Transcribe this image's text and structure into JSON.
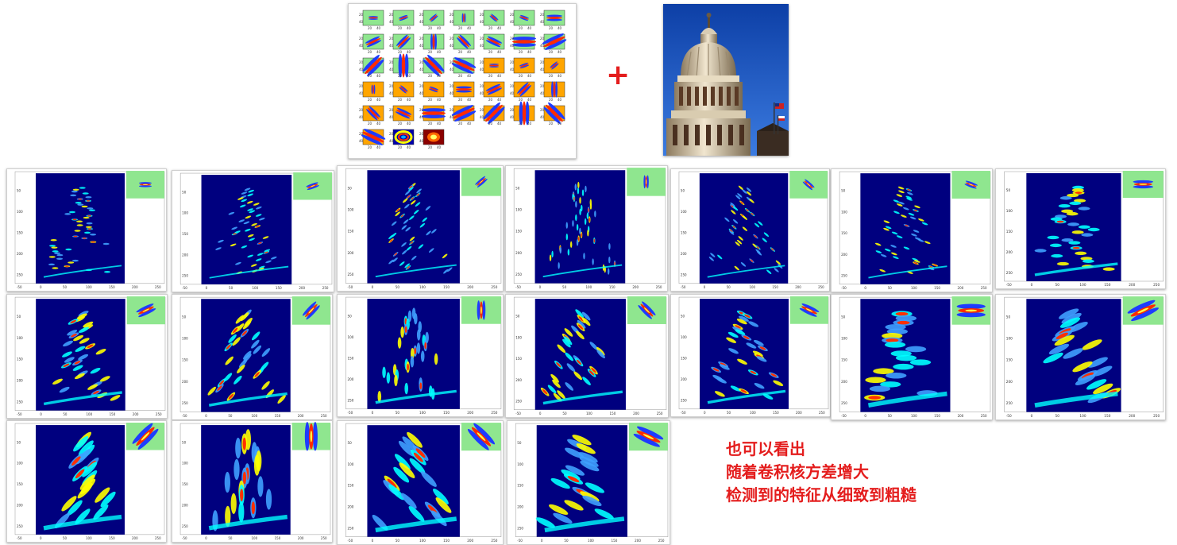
{
  "colors": {
    "accent_red": "#e41d1d",
    "map_background": "#00007f",
    "filter_bg_green": "#8fe68f",
    "filter_bg_orange": "#ffa500"
  },
  "filter_bank": {
    "tick_labels": [
      "20",
      "40"
    ],
    "rows": [
      [
        {
          "bg": "green",
          "angle": 0,
          "size": "s"
        },
        {
          "bg": "green",
          "angle": -20,
          "size": "s"
        },
        {
          "bg": "green",
          "angle": -40,
          "size": "s"
        },
        {
          "bg": "green",
          "angle": -90,
          "size": "s"
        },
        {
          "bg": "green",
          "angle": 40,
          "size": "s"
        },
        {
          "bg": "green",
          "angle": 20,
          "size": "s"
        },
        {
          "bg": "green",
          "angle": 0,
          "size": "m"
        }
      ],
      [
        {
          "bg": "green",
          "angle": -25,
          "size": "m"
        },
        {
          "bg": "green",
          "angle": -45,
          "size": "m"
        },
        {
          "bg": "green",
          "angle": -90,
          "size": "m"
        },
        {
          "bg": "green",
          "angle": 45,
          "size": "m"
        },
        {
          "bg": "green",
          "angle": 25,
          "size": "m"
        },
        {
          "bg": "green",
          "angle": 0,
          "size": "l"
        },
        {
          "bg": "green",
          "angle": -25,
          "size": "l"
        }
      ],
      [
        {
          "bg": "green",
          "angle": -45,
          "size": "l"
        },
        {
          "bg": "green",
          "angle": -90,
          "size": "l"
        },
        {
          "bg": "green",
          "angle": 45,
          "size": "l"
        },
        {
          "bg": "green",
          "angle": 25,
          "size": "l"
        },
        {
          "bg": "orange",
          "angle": 0,
          "size": "s"
        },
        {
          "bg": "orange",
          "angle": -20,
          "size": "s"
        },
        {
          "bg": "orange",
          "angle": -40,
          "size": "s"
        }
      ],
      [
        {
          "bg": "orange",
          "angle": -90,
          "size": "s"
        },
        {
          "bg": "orange",
          "angle": 40,
          "size": "s"
        },
        {
          "bg": "orange",
          "angle": 20,
          "size": "s"
        },
        {
          "bg": "orange",
          "angle": 0,
          "size": "m"
        },
        {
          "bg": "orange",
          "angle": -25,
          "size": "m"
        },
        {
          "bg": "orange",
          "angle": -45,
          "size": "m"
        },
        {
          "bg": "orange",
          "angle": -90,
          "size": "m"
        }
      ],
      [
        {
          "bg": "orange",
          "angle": 45,
          "size": "m"
        },
        {
          "bg": "orange",
          "angle": 25,
          "size": "m"
        },
        {
          "bg": "orange",
          "angle": 0,
          "size": "l"
        },
        {
          "bg": "orange",
          "angle": -25,
          "size": "l"
        },
        {
          "bg": "orange",
          "angle": -45,
          "size": "l"
        },
        {
          "bg": "orange",
          "angle": -90,
          "size": "l"
        },
        {
          "bg": "orange",
          "angle": 45,
          "size": "l"
        }
      ],
      [
        {
          "bg": "orange",
          "angle": 25,
          "size": "l"
        },
        {
          "bg": "blue",
          "kind": "ring"
        },
        {
          "bg": "darkred",
          "kind": "blob"
        }
      ]
    ]
  },
  "operator_symbol": "+",
  "response_maps": [
    {
      "kernel_angle": 0,
      "kernel_size": "s",
      "coarseness": "fine"
    },
    {
      "kernel_angle": -20,
      "kernel_size": "s",
      "coarseness": "fine"
    },
    {
      "kernel_angle": -40,
      "kernel_size": "s",
      "coarseness": "fine"
    },
    {
      "kernel_angle": -90,
      "kernel_size": "s",
      "coarseness": "fine"
    },
    {
      "kernel_angle": 40,
      "kernel_size": "s",
      "coarseness": "fine"
    },
    {
      "kernel_angle": 20,
      "kernel_size": "s",
      "coarseness": "fine"
    },
    {
      "kernel_angle": 0,
      "kernel_size": "m",
      "coarseness": "medium"
    },
    {
      "kernel_angle": -25,
      "kernel_size": "m",
      "coarseness": "medium"
    },
    {
      "kernel_angle": -45,
      "kernel_size": "m",
      "coarseness": "medium"
    },
    {
      "kernel_angle": -90,
      "kernel_size": "m",
      "coarseness": "medium"
    },
    {
      "kernel_angle": 45,
      "kernel_size": "m",
      "coarseness": "medium"
    },
    {
      "kernel_angle": 25,
      "kernel_size": "m",
      "coarseness": "medium"
    },
    {
      "kernel_angle": 0,
      "kernel_size": "l",
      "coarseness": "coarse"
    },
    {
      "kernel_angle": -25,
      "kernel_size": "l",
      "coarseness": "coarse"
    },
    {
      "kernel_angle": -45,
      "kernel_size": "l",
      "coarseness": "coarse"
    },
    {
      "kernel_angle": -90,
      "kernel_size": "l",
      "coarseness": "coarse"
    },
    {
      "kernel_angle": 45,
      "kernel_size": "l",
      "coarseness": "coarse"
    },
    {
      "kernel_angle": 25,
      "kernel_size": "l",
      "coarseness": "coarse"
    }
  ],
  "response_axis_ticks": {
    "x": [
      "-50",
      "0",
      "50",
      "100",
      "150",
      "200",
      "250"
    ],
    "y": [
      "50",
      "100",
      "150",
      "200",
      "250"
    ]
  },
  "caption": {
    "line1": "也可以看出",
    "line2": "随着卷积核方差增大",
    "line3": "检测到的特征从细致到粗糙"
  }
}
